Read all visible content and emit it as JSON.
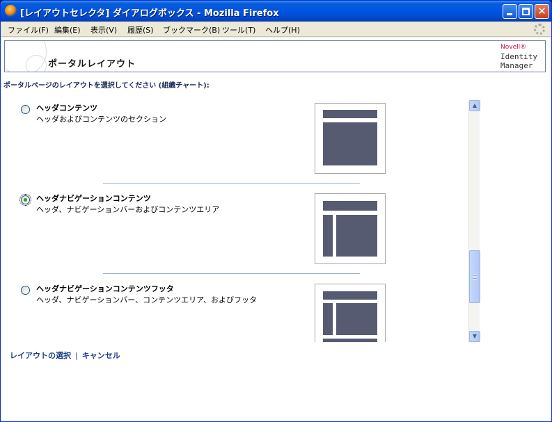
{
  "window": {
    "title": "[レイアウトセレクタ] ダイアログボックス - Mozilla Firefox",
    "close_glyph": "✕"
  },
  "menu": [
    {
      "label": "ファイル(F)"
    },
    {
      "label": "編集(E)"
    },
    {
      "label": "表示(V)"
    },
    {
      "label": "履歴(S)"
    },
    {
      "label": "ブックマーク(B)"
    },
    {
      "label": "ツール(T)"
    },
    {
      "label": "ヘルプ(H)"
    }
  ],
  "header": {
    "title": "ポータルレイアウト",
    "brand": {
      "novell": "Novell®",
      "line1": "Identity",
      "line2": "Manager"
    }
  },
  "prompt": "ポータルページのレイアウトを選択してください (組織チャート):",
  "options": [
    {
      "title": "ヘッダコンテンツ",
      "description": "ヘッダおよびコンテンツのセクション",
      "selected": false
    },
    {
      "title": "ヘッダナビゲーションコンテンツ",
      "description": "ヘッダ、ナビゲーションバーおよびコンテンツエリア",
      "selected": true
    },
    {
      "title": "ヘッダナビゲーションコンテンツフッタ",
      "description": "ヘッダ、ナビゲーションバー、コンテンツエリア、およびフッタ",
      "selected": false
    }
  ],
  "scrollbar": {
    "up_glyph": "▲",
    "down_glyph": "▼"
  },
  "actions": {
    "select_label": "レイアウトの選択",
    "separator": "|",
    "cancel_label": "キャンセル"
  },
  "colors": {
    "titlebar": "#0054e3",
    "layout_block": "#575b72",
    "link": "#1a3e8c",
    "separator": "#9db3cc"
  }
}
